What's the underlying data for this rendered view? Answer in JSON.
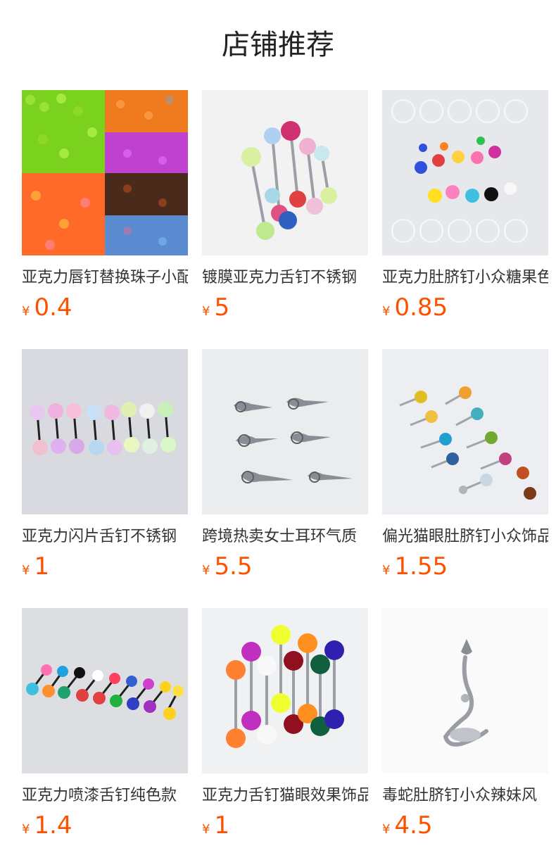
{
  "page": {
    "title": "店铺推荐"
  },
  "colors": {
    "price": "#ff5000",
    "title": "#222222",
    "background": "#ffffff"
  },
  "products": [
    {
      "title": "亚克力唇钉替换珠子小配件",
      "currency": "¥",
      "price": "0.4",
      "image": "colorful-acrylic-beads-photo"
    },
    {
      "title": "镀膜亚克力舌钉不锈钢",
      "currency": "¥",
      "price": "5",
      "image": "coated-acrylic-tongue-rings-photo"
    },
    {
      "title": "亚克力肚脐钉小众糖果色",
      "currency": "¥",
      "price": "0.85",
      "image": "acrylic-belly-rings-photo"
    },
    {
      "title": "亚克力闪片舌钉不锈钢",
      "currency": "¥",
      "price": "1",
      "image": "glitter-tongue-rings-photo"
    },
    {
      "title": "跨境热卖女士耳环气质",
      "currency": "¥",
      "price": "5.5",
      "image": "spike-earrings-photo"
    },
    {
      "title": "偏光猫眼肚脐钉小众饰品",
      "currency": "¥",
      "price": "1.55",
      "image": "cat-eye-belly-rings-photo"
    },
    {
      "title": "亚克力喷漆舌钉纯色款",
      "currency": "¥",
      "price": "1.4",
      "image": "painted-tongue-rings-photo"
    },
    {
      "title": "亚克力舌钉猫眼效果饰品",
      "currency": "¥",
      "price": "1",
      "image": "cat-eye-tongue-rings-photo"
    },
    {
      "title": "毒蛇肚脐钉小众辣妹风",
      "currency": "¥",
      "price": "4.5",
      "image": "snake-belly-ring-photo"
    }
  ]
}
